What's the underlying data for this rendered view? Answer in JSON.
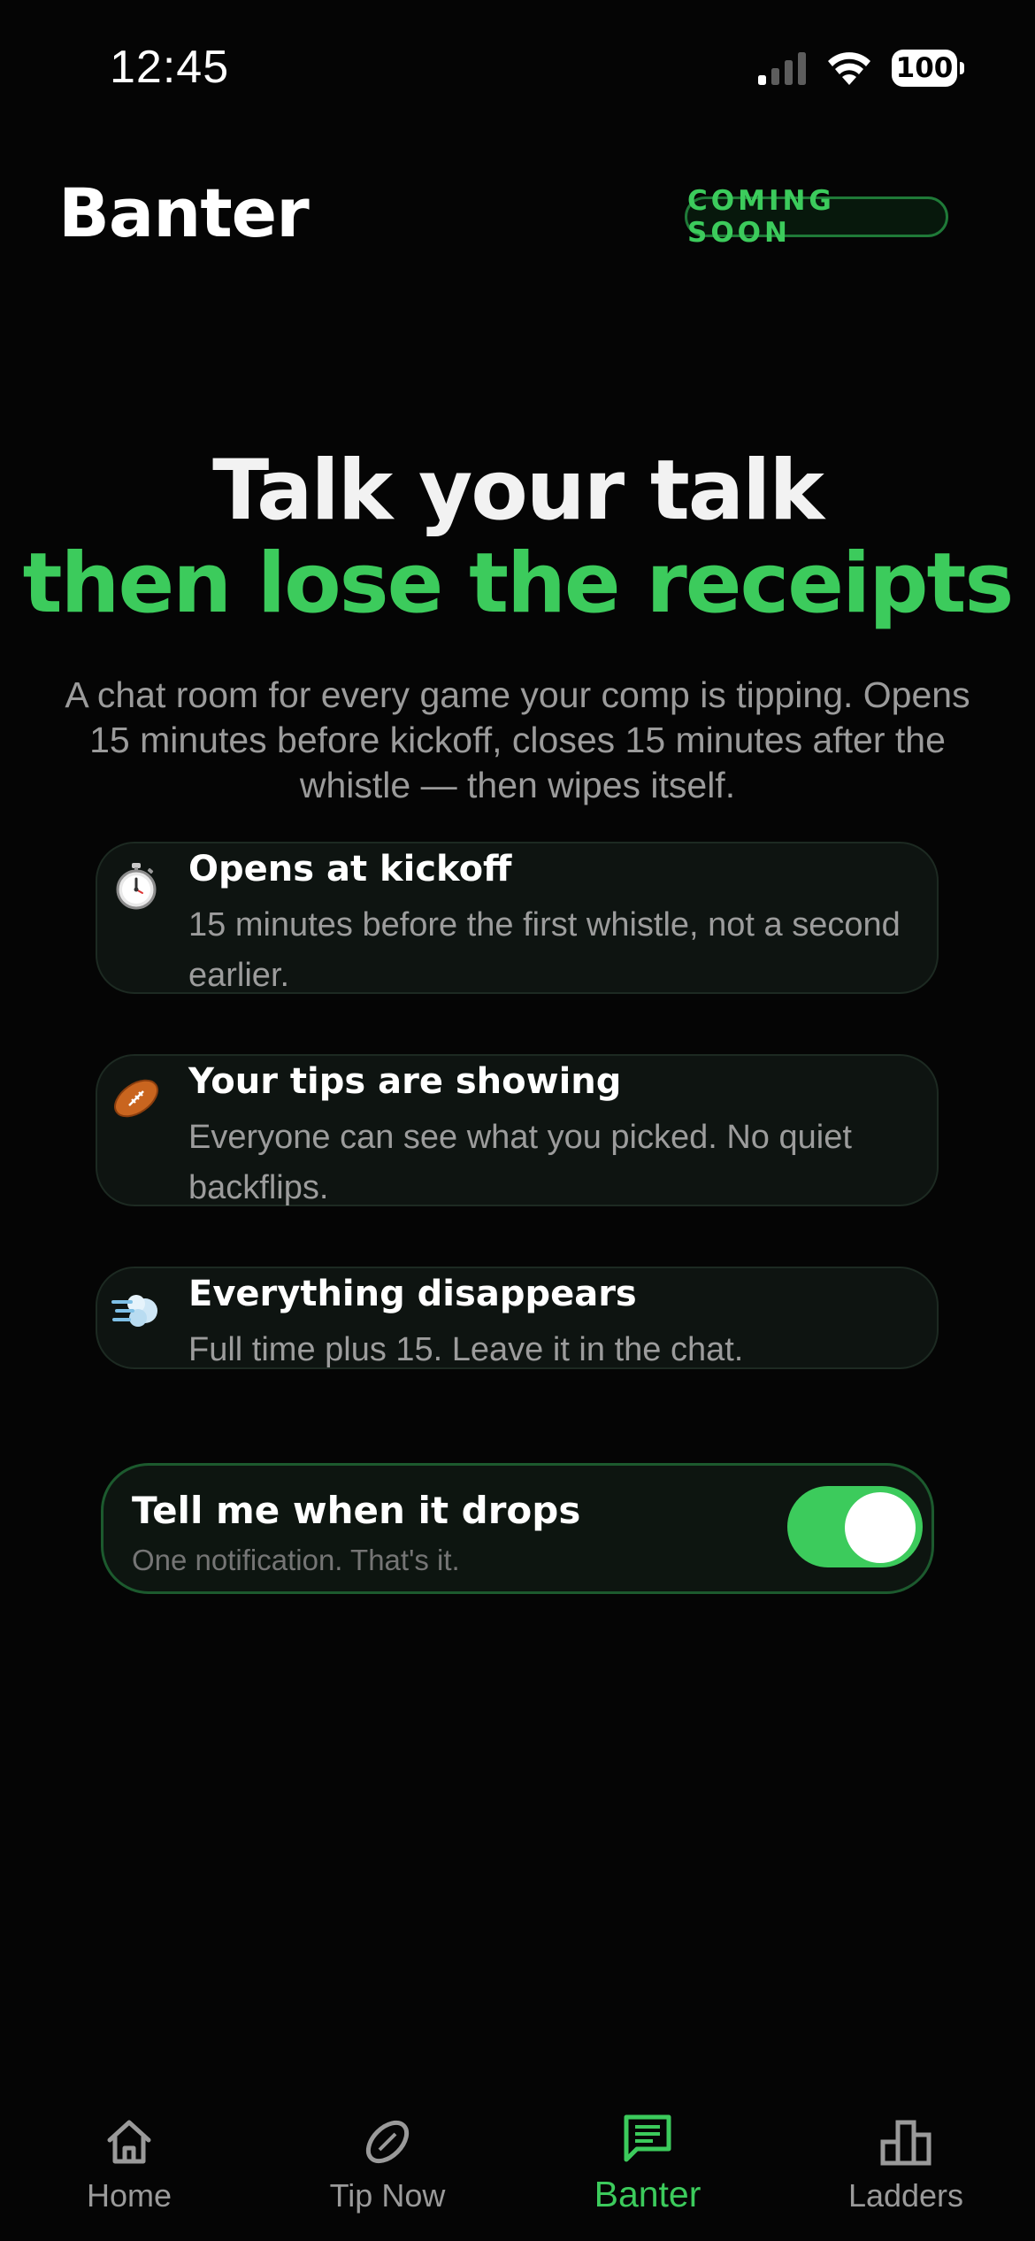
{
  "status_bar": {
    "time": "12:45",
    "battery": "100"
  },
  "header": {
    "title": "Banter",
    "badge": "COMING SOON"
  },
  "hero": {
    "line1": "Talk your talk",
    "line2": "then lose the receipts",
    "subtitle": "A chat room for every game your comp is tipping. Opens 15 minutes before kickoff, closes 15 minutes after the whistle — then wipes itself."
  },
  "features": [
    {
      "icon": "stopwatch-icon",
      "title": "Opens at kickoff",
      "description": "15 minutes before the first whistle, not a second earlier."
    },
    {
      "icon": "football-icon",
      "title": "Your tips are showing",
      "description": "Everyone can see what you picked. No quiet backflips."
    },
    {
      "icon": "dash-icon",
      "title": "Everything disappears",
      "description": "Full time plus 15. Leave it in the chat."
    }
  ],
  "notify": {
    "title": "Tell me when it drops",
    "subtitle": "One notification. That's it.",
    "enabled": true
  },
  "nav": {
    "items": [
      {
        "label": "Home",
        "icon": "home-icon"
      },
      {
        "label": "Tip Now",
        "icon": "football-outline-icon"
      },
      {
        "label": "Banter",
        "icon": "chat-icon",
        "active": true
      },
      {
        "label": "Ladders",
        "icon": "podium-icon"
      }
    ]
  },
  "colors": {
    "accent": "#3ccb5c",
    "background": "#050505",
    "card": "#0e1411"
  }
}
